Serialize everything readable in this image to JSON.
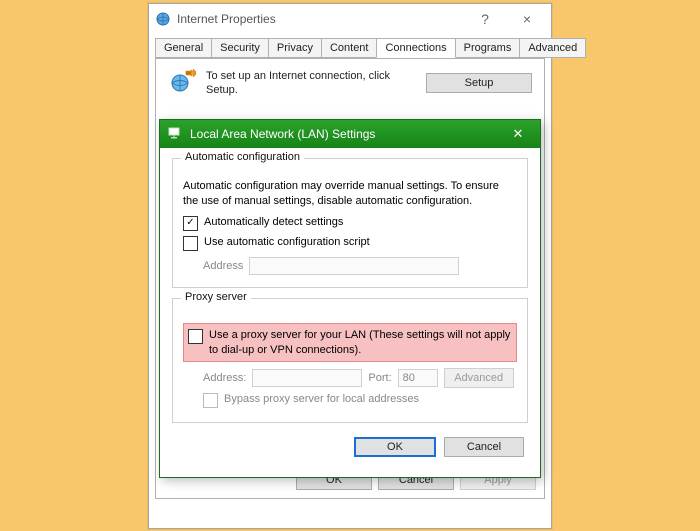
{
  "propsWindow": {
    "title": "Internet Properties",
    "help": "?",
    "close": "×",
    "tabs": [
      "General",
      "Security",
      "Privacy",
      "Content",
      "Connections",
      "Programs",
      "Advanced"
    ],
    "activeTab": 4,
    "setupText": "To set up an Internet connection, click Setup.",
    "setupBtn": "Setup",
    "ok": "OK",
    "cancel": "Cancel",
    "apply": "Apply"
  },
  "lanDialog": {
    "title": "Local Area Network (LAN) Settings",
    "close": "✕",
    "autoGroup": "Automatic configuration",
    "autoDesc": "Automatic configuration may override manual settings.  To ensure the use of manual settings, disable automatic configuration.",
    "autoDetect": "Automatically detect settings",
    "useScript": "Use automatic configuration script",
    "addressLabel": "Address",
    "proxyGroup": "Proxy server",
    "useProxy": "Use a proxy server for your LAN (These settings will not apply to dial-up or VPN connections).",
    "proxyAddressLabel": "Address:",
    "portLabel": "Port:",
    "portValue": "80",
    "advanced": "Advanced",
    "bypass": "Bypass proxy server for local addresses",
    "ok": "OK",
    "cancel": "Cancel"
  }
}
